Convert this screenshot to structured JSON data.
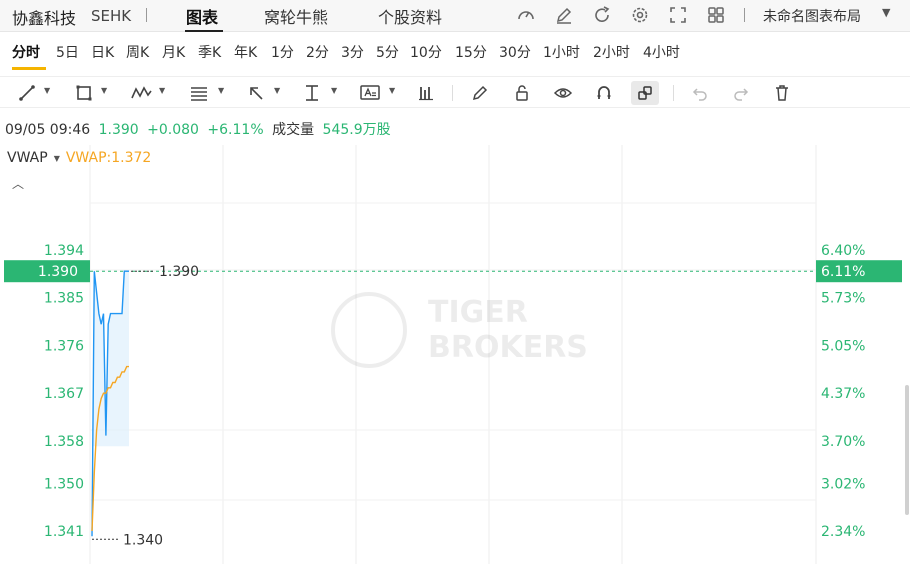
{
  "header": {
    "stock_name": "协鑫科技",
    "market": "SEHK",
    "tabs": [
      {
        "label": "图表",
        "active": true
      },
      {
        "label": "窝轮牛熊",
        "active": false
      },
      {
        "label": "个股资料",
        "active": false
      }
    ],
    "icons": [
      "speedometer-icon",
      "edit-icon",
      "refresh-icon",
      "settings-icon",
      "fullscreen-icon",
      "grid-layout-icon"
    ],
    "layout_label": "未命名图表布局"
  },
  "periods": [
    "分时",
    "5日",
    "日K",
    "周K",
    "月K",
    "季K",
    "年K",
    "1分",
    "2分",
    "3分",
    "5分",
    "10分",
    "15分",
    "30分",
    "1小时",
    "2小时",
    "4小时"
  ],
  "active_period": "分时",
  "toolbar": [
    "trend-line-icon",
    "rectangle-icon",
    "pattern-icon",
    "fibonacci-icon",
    "arrow-icon",
    "measure-icon",
    "text-note-icon",
    "bar-chart-icon",
    "pencil-icon",
    "lock-icon",
    "eye-icon",
    "magnet-icon",
    "link-icon",
    "undo-icon",
    "redo-icon",
    "delete-icon"
  ],
  "quote": {
    "datetime": "09/05 09:46",
    "price": "1.390",
    "change": "+0.080",
    "change_pct": "+6.11%",
    "volume_label": "成交量",
    "volume": "545.9万股"
  },
  "indicator": {
    "name": "VWAP",
    "value_label": "VWAP:1.372"
  },
  "colors": {
    "up": "#2bb673",
    "price_line": "#2196f3",
    "vwap_line": "#f5a623",
    "accent": "#f5b400"
  },
  "watermark": [
    "TIGER",
    "BROKERS"
  ],
  "chart_data": {
    "type": "line",
    "y_ticks": [
      1.394,
      1.385,
      1.376,
      1.367,
      1.358,
      1.35,
      1.341
    ],
    "y_tick_labels": [
      "1.394",
      "1.385",
      "1.376",
      "1.367",
      "1.358",
      "1.350",
      "1.341"
    ],
    "pct_tick_labels": [
      "6.40%",
      "5.73%",
      "5.05%",
      "4.37%",
      "3.70%",
      "3.02%",
      "2.34%"
    ],
    "ylim": [
      1.338,
      1.398
    ],
    "current_price": 1.39,
    "current_price_label": "1.390",
    "current_pct_label": "6.11%",
    "high_label": "1.390",
    "low_label": "1.340",
    "x_minutes": [
      0,
      1,
      2,
      3,
      4,
      5,
      6,
      7,
      8,
      9,
      10,
      11,
      12,
      13,
      14,
      15,
      16
    ],
    "series": [
      {
        "name": "price",
        "values": [
          1.34,
          1.39,
          1.386,
          1.382,
          1.38,
          1.382,
          1.359,
          1.38,
          1.382,
          1.382,
          1.382,
          1.382,
          1.382,
          1.382,
          1.39,
          1.39,
          1.39
        ]
      },
      {
        "name": "VWAP",
        "values": [
          1.341,
          1.352,
          1.36,
          1.364,
          1.366,
          1.367,
          1.367,
          1.368,
          1.368,
          1.369,
          1.369,
          1.37,
          1.37,
          1.371,
          1.371,
          1.372,
          1.372
        ]
      }
    ]
  }
}
